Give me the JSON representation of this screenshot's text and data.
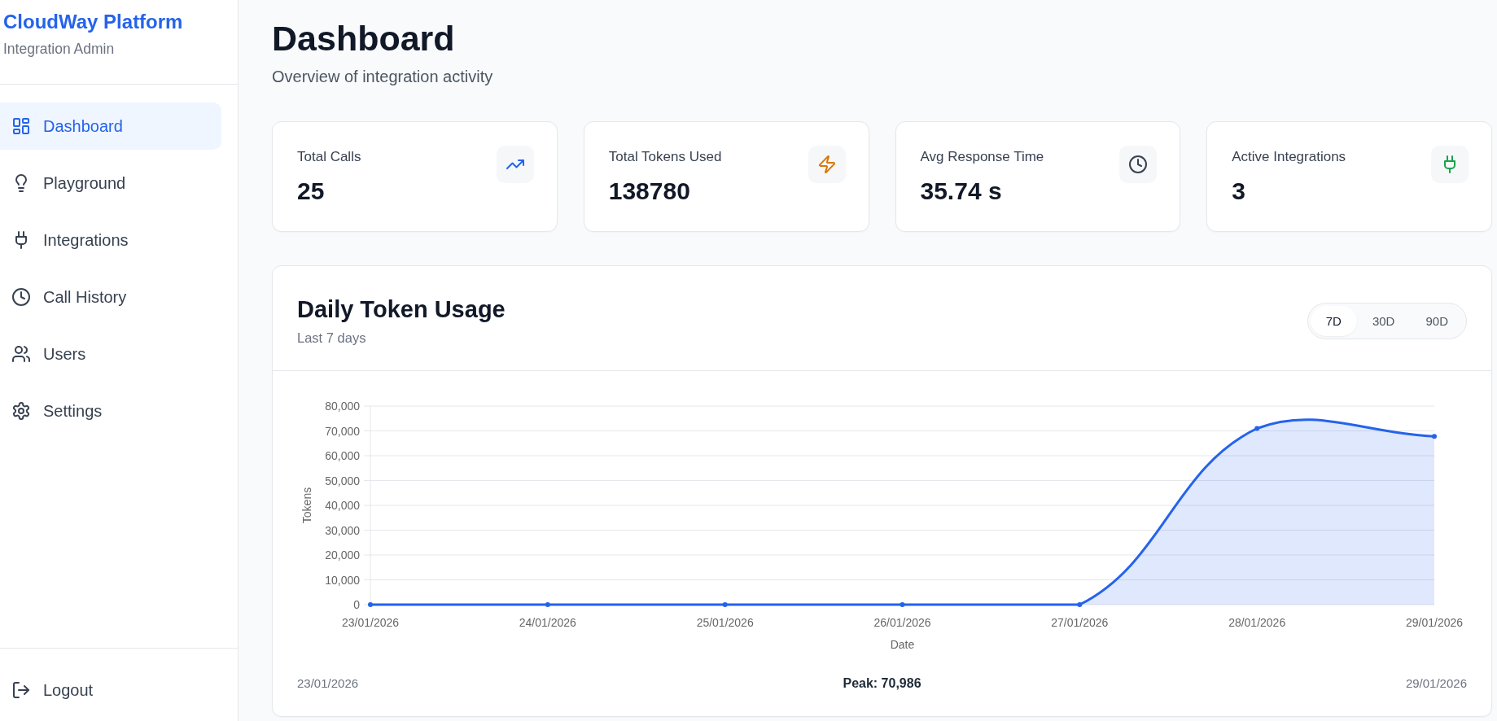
{
  "sidebar": {
    "brand": "CloudWay Platform",
    "subtitle": "Integration Admin",
    "items": [
      {
        "label": "Dashboard",
        "selected": true
      },
      {
        "label": "Playground",
        "selected": false
      },
      {
        "label": "Integrations",
        "selected": false
      },
      {
        "label": "Call History",
        "selected": false
      },
      {
        "label": "Users",
        "selected": false
      },
      {
        "label": "Settings",
        "selected": false
      }
    ],
    "logout": "Logout"
  },
  "header": {
    "title": "Dashboard",
    "subtitle": "Overview of integration activity"
  },
  "stats": [
    {
      "label": "Total Calls",
      "value": "25",
      "color": "#2563eb"
    },
    {
      "label": "Total Tokens Used",
      "value": "138780",
      "color": "#d97706"
    },
    {
      "label": "Avg Response Time",
      "value": "35.74 s",
      "color": "#374151"
    },
    {
      "label": "Active Integrations",
      "value": "3",
      "color": "#16a34a"
    }
  ],
  "usage": {
    "title": "Daily Token Usage",
    "subtitle": "Last 7 days",
    "ranges": [
      {
        "label": "7D",
        "selected": true
      },
      {
        "label": "30D",
        "selected": false
      },
      {
        "label": "90D",
        "selected": false
      }
    ],
    "chart_data": {
      "type": "area",
      "xlabel": "Date",
      "ylabel": "Tokens",
      "grid": true,
      "categories": [
        "23/01/2026",
        "24/01/2026",
        "25/01/2026",
        "26/01/2026",
        "27/01/2026",
        "28/01/2026",
        "29/01/2026"
      ],
      "series": [
        {
          "color": "#2563eb",
          "values": [
            0,
            0,
            0,
            0,
            0,
            70986,
            67800
          ]
        }
      ],
      "ylim": [
        0,
        80000
      ],
      "yticks": [
        {
          "value": 0,
          "label": "0"
        },
        {
          "value": 10000,
          "label": "10,000"
        },
        {
          "value": 20000,
          "label": "20,000"
        },
        {
          "value": 30000,
          "label": "30,000"
        },
        {
          "value": 40000,
          "label": "40,000"
        },
        {
          "value": 50000,
          "label": "50,000"
        },
        {
          "value": 60000,
          "label": "60,000"
        },
        {
          "value": 70000,
          "label": "70,000"
        },
        {
          "value": 80000,
          "label": "80,000"
        }
      ]
    },
    "footer": {
      "start": "23/01/2026",
      "peak": "Peak: 70,986",
      "end": "29/01/2026"
    }
  }
}
